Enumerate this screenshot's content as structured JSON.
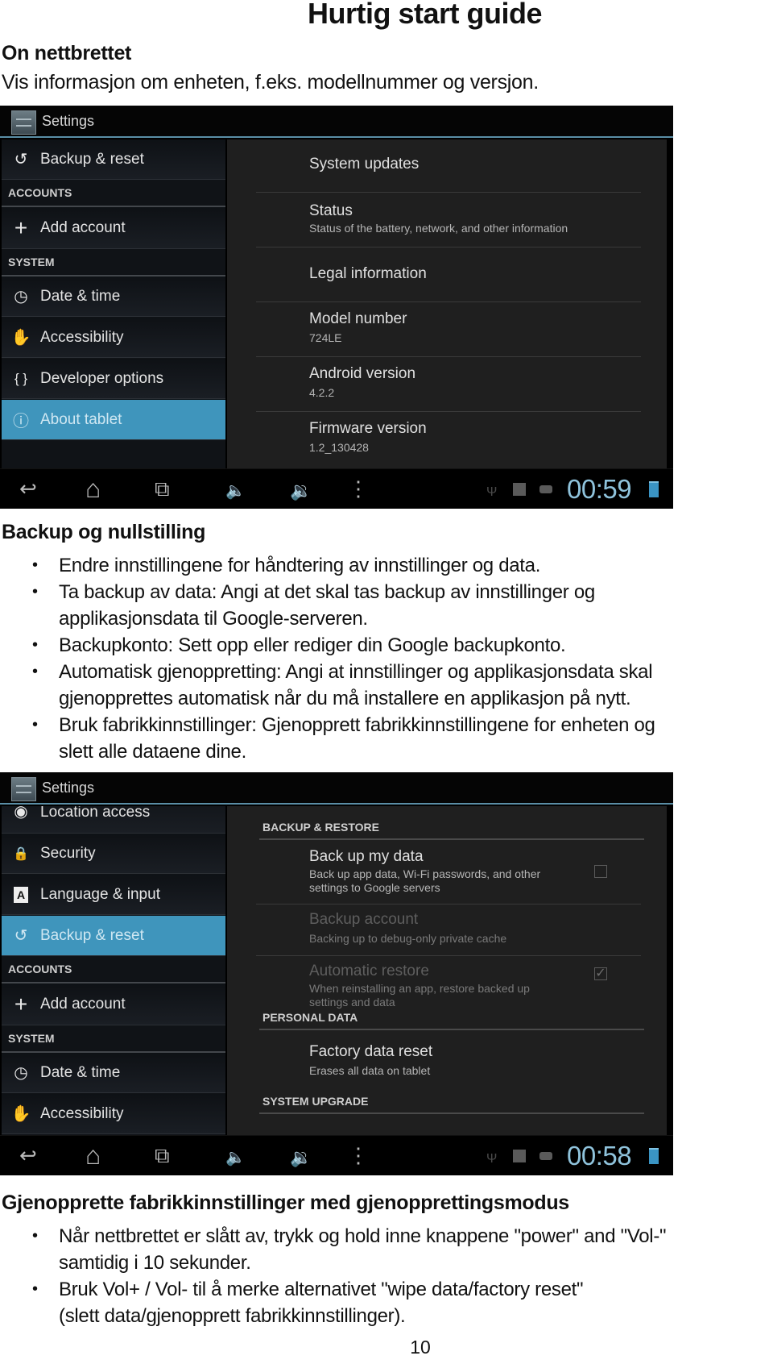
{
  "document": {
    "title": "Hurtig start guide",
    "page_number": "10"
  },
  "section1": {
    "heading": "On nettbrettet",
    "text": "Vis informasjon om enheten, f.eks. modellnummer og versjon."
  },
  "screen1": {
    "app_title": "Settings",
    "sidebar": [
      {
        "type": "item",
        "icon": "backup-restore-icon",
        "glyph": "↺",
        "label": "Backup & reset",
        "selected": false
      },
      {
        "type": "header",
        "label": "ACCOUNTS"
      },
      {
        "type": "item",
        "icon": "plus-icon",
        "glyph": "+",
        "label": "Add account",
        "selected": false
      },
      {
        "type": "header",
        "label": "SYSTEM"
      },
      {
        "type": "item",
        "icon": "clock-icon",
        "glyph": "◷",
        "label": "Date & time",
        "selected": false
      },
      {
        "type": "item",
        "icon": "hand-icon",
        "glyph": "✋",
        "label": "Accessibility",
        "selected": false
      },
      {
        "type": "item",
        "icon": "braces-icon",
        "glyph": "{ }",
        "label": "Developer options",
        "selected": false
      },
      {
        "type": "item",
        "icon": "info-icon",
        "glyph": "ⓘ",
        "label": "About tablet",
        "selected": true
      }
    ],
    "prefs": [
      {
        "title": "System updates",
        "summary": ""
      },
      {
        "title": "Status",
        "summary": "Status of the battery, network, and other information"
      },
      {
        "title": "Legal information",
        "summary": ""
      },
      {
        "title": "Model number",
        "summary": "724LE"
      },
      {
        "title": "Android version",
        "summary": "4.2.2"
      },
      {
        "title": "Firmware version",
        "summary": "1.2_130428"
      }
    ],
    "clock": "00:59"
  },
  "section2": {
    "heading": "Backup og nullstilling",
    "bullets": [
      [
        "Endre innstillingene for håndtering av innstillinger og data."
      ],
      [
        "Ta backup av data: Angi at det skal tas backup av innstillinger og",
        "applikasjonsdata til Google-serveren."
      ],
      [
        "Backupkonto: Sett opp eller rediger din Google backupkonto."
      ],
      [
        "Automatisk gjenoppretting: Angi at innstillinger og applikasjonsdata skal",
        "gjenopprettes automatisk når du må installere en applikasjon på nytt."
      ],
      [
        "Bruk fabrikkinnstillinger: Gjenopprett fabrikkinnstillingene for enheten og",
        "slett alle dataene dine."
      ]
    ]
  },
  "screen2": {
    "app_title": "Settings",
    "sidebar": [
      {
        "type": "item",
        "icon": "location-icon",
        "glyph": "◉",
        "label": "Location access",
        "selected": false
      },
      {
        "type": "item",
        "icon": "lock-icon",
        "glyph": "🔒",
        "label": "Security",
        "selected": false
      },
      {
        "type": "item",
        "icon": "language-icon",
        "glyph": "A",
        "label": "Language & input",
        "selected": false
      },
      {
        "type": "item",
        "icon": "backup-restore-icon",
        "glyph": "↺",
        "label": "Backup & reset",
        "selected": true
      },
      {
        "type": "header",
        "label": "ACCOUNTS"
      },
      {
        "type": "item",
        "icon": "plus-icon",
        "glyph": "+",
        "label": "Add account",
        "selected": false
      },
      {
        "type": "header",
        "label": "SYSTEM"
      },
      {
        "type": "item",
        "icon": "clock-icon",
        "glyph": "◷",
        "label": "Date & time",
        "selected": false
      },
      {
        "type": "item",
        "icon": "hand-icon",
        "glyph": "✋",
        "label": "Accessibility",
        "selected": false
      }
    ],
    "categories": {
      "backup_restore": "BACKUP & RESTORE",
      "personal_data": "PERSONAL DATA",
      "system_upgrade": "SYSTEM UPGRADE"
    },
    "prefs": [
      {
        "title": "Back up my data",
        "summary": [
          "Back up app data, Wi-Fi passwords, and other",
          "settings to Google servers"
        ],
        "enabled": true,
        "checkbox": "unchecked"
      },
      {
        "title": "Backup account",
        "summary": [
          "Backing up to debug-only private cache"
        ],
        "enabled": false
      },
      {
        "title": "Automatic restore",
        "summary": [
          "When reinstalling an app, restore backed up",
          "settings and data"
        ],
        "enabled": false,
        "checkbox": "checked"
      },
      {
        "title": "Factory data reset",
        "summary": [
          "Erases all data on tablet"
        ],
        "enabled": true
      }
    ],
    "clock": "00:58"
  },
  "navbar_icons": {
    "back": "↩",
    "home": "⌂",
    "recents": "⧉",
    "vol_down": "🔈",
    "vol_up": "🔉",
    "menu": "⋮",
    "usb": "Ψ"
  },
  "section3": {
    "heading": "Gjenopprette fabrikkinnstillinger med gjenopprettingsmodus",
    "bullets": [
      [
        "Når nettbrettet er slått av, trykk og hold inne knappene \"power\" and \"Vol-\"",
        "samtidig i 10 sekunder."
      ],
      [
        "Bruk Vol+ / Vol- til å merke alternativet \"wipe data/factory reset\"",
        "(slett data/gjenopprett fabrikkinnstillinger)."
      ]
    ]
  },
  "colors": {
    "selected_item": "#3f95bc",
    "clock_text": "#8fc3dc",
    "action_bar_divider": "#5a8ea6"
  }
}
